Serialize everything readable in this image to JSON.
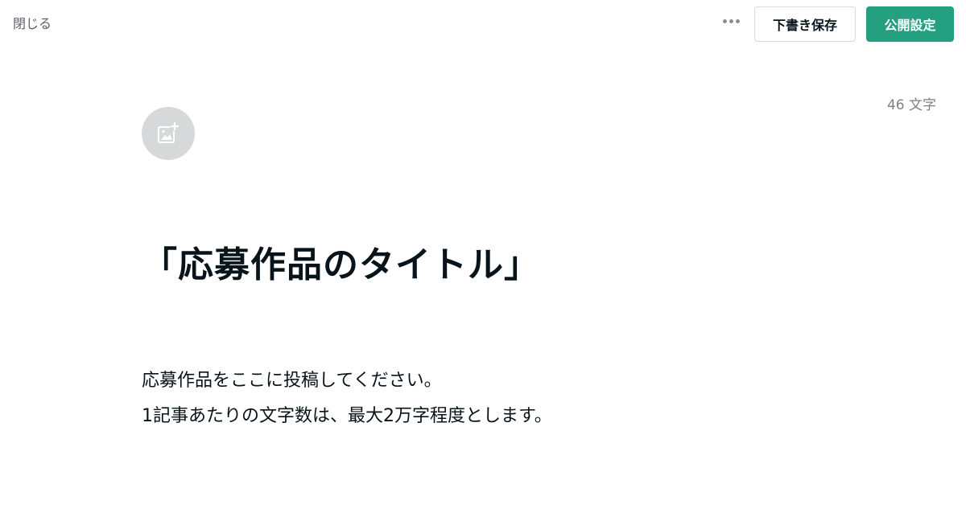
{
  "header": {
    "close_label": "閉じる",
    "more_icon": "more-horizontal-icon",
    "draft_label": "下書き保存",
    "publish_label": "公開設定"
  },
  "editor": {
    "char_count": "46 文字",
    "image_icon": "add-image-icon",
    "title": "「応募作品のタイトル」",
    "body": [
      "応募作品をここに投稿してください。",
      "1記事あたりの文字数は、最大2万字程度とします。"
    ]
  },
  "colors": {
    "accent": "#249f80",
    "text": "#08131a",
    "muted": "#7c8185"
  }
}
